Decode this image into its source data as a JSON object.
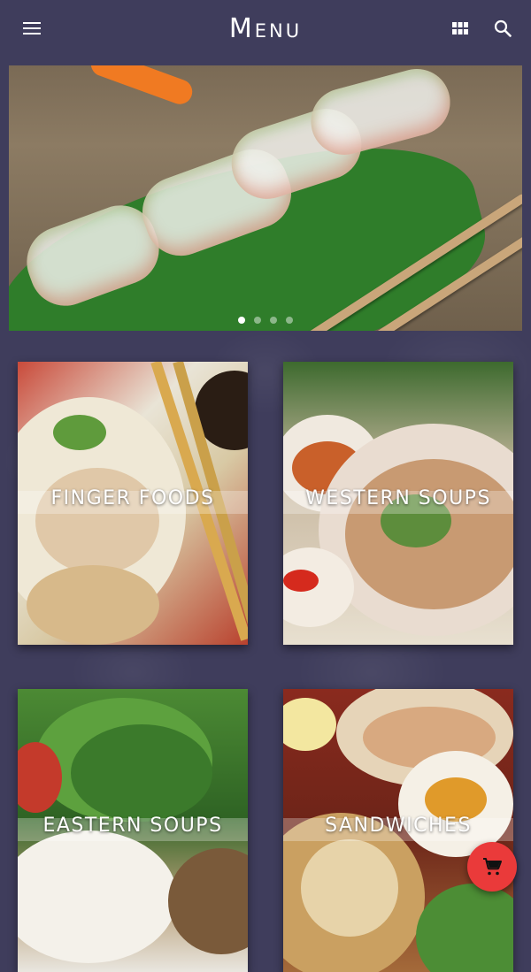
{
  "app": {
    "title": "Menu",
    "accent": "#ea3a3a",
    "background": "#3f3d5c"
  },
  "toolbar": {
    "menu_icon": "hamburger-menu-icon",
    "grid_icon": "grid-view-icon",
    "search_icon": "search-icon"
  },
  "banner": {
    "image": "vietnamese-spring-rolls-on-banana-leaf",
    "slides": 4,
    "active_slide": 1
  },
  "categories": [
    {
      "label": "FINGER FOODS",
      "image": "noodle-dish-with-chopsticks"
    },
    {
      "label": "WESTERN SOUPS",
      "image": "pho-soup-bowl-with-herbs"
    },
    {
      "label": "EASTERN SOUPS",
      "image": "fresh-herbs-and-rice"
    },
    {
      "label": "SANDWICHES",
      "image": "spring-rolls-and-dipping-sauce"
    }
  ],
  "fab": {
    "icon": "shopping-cart-icon"
  }
}
